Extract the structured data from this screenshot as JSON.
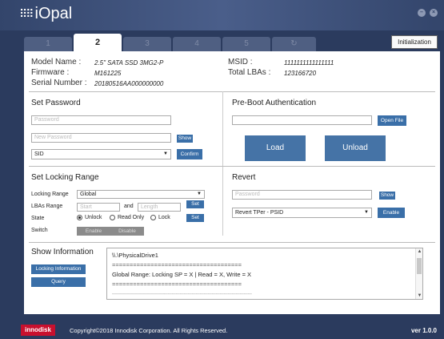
{
  "app": {
    "logo_text": "iOpal",
    "logo_mark": "⠿⠿",
    "window_controls": [
      "minimize-icon",
      "close-icon"
    ]
  },
  "tabs": [
    {
      "label": "1"
    },
    {
      "label": "2"
    },
    {
      "label": "3"
    },
    {
      "label": "4"
    },
    {
      "label": "5"
    },
    {
      "label": "↻"
    }
  ],
  "active_tab": "2",
  "initialization_label": "Initialization",
  "drive_info": {
    "model_label": "Model Name :",
    "model_value": "2.5\" SATA SSD 3MG2-P",
    "firmware_label": "Firmware :",
    "firmware_value": "M161225",
    "serial_label": "Serial Number :",
    "serial_value": "20180516AA000000000",
    "msid_label": "MSID :",
    "msid_value": "1111111111111111",
    "lbas_label": "Total LBAs :",
    "lbas_value": "123166720"
  },
  "set_password": {
    "title": "Set Password",
    "password_placeholder": "Password",
    "new_password_placeholder": "New Password",
    "show_label": "Show",
    "user_select": "SID",
    "confirm_label": "Confirm"
  },
  "pre_boot": {
    "title": "Pre-Boot Authentication",
    "file_value": "",
    "open_file_label": "Open File",
    "load_label": "Load",
    "unload_label": "Unload"
  },
  "locking_range": {
    "title": "Set Locking Range",
    "range_label": "Locking Range",
    "range_select": "Global",
    "lbas_label": "LBAs Range",
    "start_placeholder": "Start",
    "and_label": "and",
    "length_placeholder": "Length",
    "set_label": "Set",
    "state_label": "State",
    "states": [
      "Unlock",
      "Read Only",
      "Lock"
    ],
    "selected_state": "Unlock",
    "switch_label": "Switch",
    "enable_label": "Enable",
    "disable_label": "Disable"
  },
  "revert": {
    "title": "Revert",
    "password_placeholder": "Password",
    "show_label": "Show",
    "mode_select": "Revert TPer - PSID",
    "enable_label": "Enable"
  },
  "show_info": {
    "title": "Show Information",
    "locking_info_label": "Locking Information",
    "query_label": "Query",
    "lines": [
      "\\\\.\\PhysicalDrive1",
      "=====================================",
      "Global Range: Locking SP = X | Read = X, Write = X",
      "=====================================",
      "----------------------------------------------------------------------"
    ]
  },
  "footer": {
    "brand": "innodisk",
    "copyright": "Copyright©2018 Innodisk Corporation. All Rights Reserved.",
    "version": "ver 1.0.0"
  },
  "colors": {
    "titlebar": "#33456b",
    "button": "#3a6fa8",
    "brand": "#c8102e"
  }
}
